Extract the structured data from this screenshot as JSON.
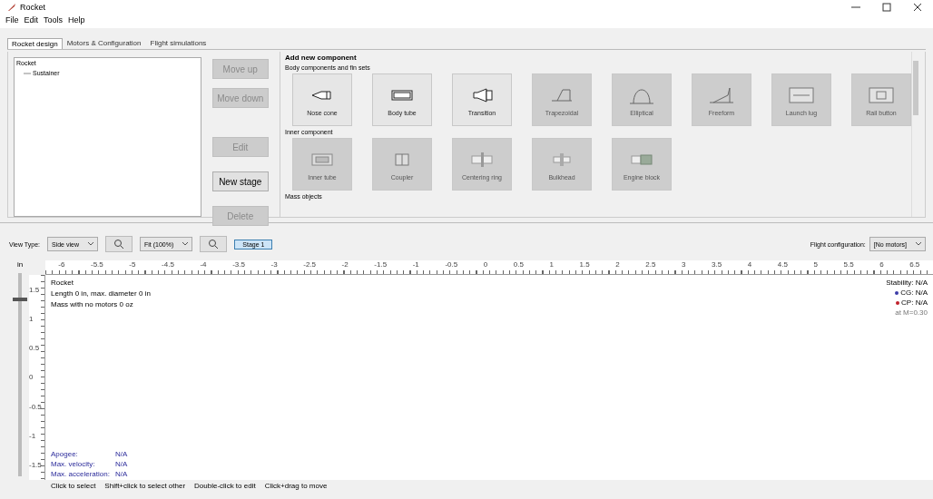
{
  "window": {
    "title": "Rocket"
  },
  "menu": [
    "File",
    "Edit",
    "Tools",
    "Help"
  ],
  "tabs": [
    {
      "label": "Rocket design",
      "selected": true
    },
    {
      "label": "Motors & Configuration",
      "selected": false
    },
    {
      "label": "Flight simulations",
      "selected": false
    }
  ],
  "tree": [
    {
      "label": "Rocket",
      "children": [
        {
          "label": "Sustainer"
        }
      ]
    }
  ],
  "tree_buttons": [
    {
      "label": "Move up",
      "disabled": true
    },
    {
      "label": "Move down",
      "disabled": true
    },
    {
      "label": "Edit",
      "disabled": true
    },
    {
      "label": "New stage",
      "disabled": false
    },
    {
      "label": "Delete",
      "disabled": true
    }
  ],
  "add_component": {
    "title": "Add new component",
    "groups": [
      {
        "title": "Body components and fin sets",
        "items": [
          {
            "label": "Nose cone",
            "disabled": false
          },
          {
            "label": "Body tube",
            "disabled": false
          },
          {
            "label": "Transition",
            "disabled": false
          },
          {
            "label": "Trapezoidal",
            "disabled": true
          },
          {
            "label": "Elliptical",
            "disabled": true
          },
          {
            "label": "Freeform",
            "disabled": true
          },
          {
            "label": "Launch lug",
            "disabled": true
          },
          {
            "label": "Rail button",
            "disabled": true
          }
        ]
      },
      {
        "title": "Inner component",
        "items": [
          {
            "label": "Inner tube",
            "disabled": true
          },
          {
            "label": "Coupler",
            "disabled": true
          },
          {
            "label": "Centering ring",
            "disabled": true
          },
          {
            "label": "Bulkhead",
            "disabled": true
          },
          {
            "label": "Engine block",
            "disabled": true
          }
        ]
      },
      {
        "title": "Mass objects"
      }
    ]
  },
  "view": {
    "view_type_label": "View Type:",
    "view_type": "Side view",
    "zoom": "Fit (100%)",
    "stage": {
      "label": "Stage 1",
      "selected": true
    },
    "flight_config_label": "Flight configuration:",
    "flight_config": "[No motors]"
  },
  "ruler": {
    "unit": "in",
    "x_labels": [
      "-6",
      "-5.5",
      "-5",
      "-4.5",
      "-4",
      "-3.5",
      "-3",
      "-2.5",
      "-2",
      "-1.5",
      "-1",
      "-0.5",
      "0",
      "0.5",
      "1",
      "1.5",
      "2",
      "2.5",
      "3",
      "3.5",
      "4",
      "4.5",
      "5",
      "5.5",
      "6",
      "6.5"
    ],
    "y_labels": [
      "1.5",
      "1",
      "0.5",
      "0",
      "-0.5",
      "-1",
      "-1.5"
    ]
  },
  "zoom_slider": {
    "level": 0.88
  },
  "rocket_info": [
    "Rocket",
    "Length 0 in, max. diameter 0 in",
    "Mass with no motors 0 oz"
  ],
  "stability": {
    "title": "Stability: N/A",
    "items": [
      {
        "label": "CG: N/A",
        "color": "#3c3ca8"
      },
      {
        "label": "CP: N/A",
        "color": "#c0202a"
      }
    ],
    "note": "at M=0.30"
  },
  "flight_data": [
    {
      "label": "Apogee:",
      "value": "N/A"
    },
    {
      "label": "Max. velocity:",
      "value": "N/A"
    },
    {
      "label": "Max. acceleration:",
      "value": "N/A"
    }
  ],
  "status_bar": [
    "Click to select",
    "Shift+click to select other",
    "Double-click to edit",
    "Click+drag to move"
  ]
}
